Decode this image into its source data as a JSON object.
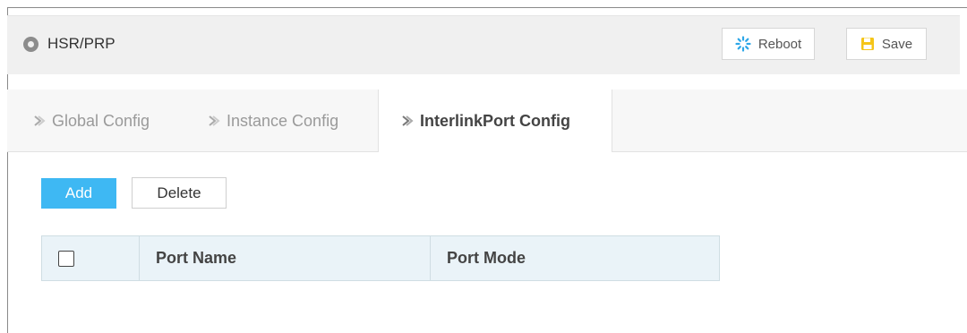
{
  "header": {
    "title": "HSR/PRP",
    "location_icon": "location-pin-icon",
    "reboot_label": "Reboot",
    "reboot_icon": "spinner-icon",
    "save_label": "Save",
    "save_icon": "floppy-disk-icon"
  },
  "tabs": [
    {
      "label": "Global Config",
      "icon": "chevron-right-icon",
      "active": false
    },
    {
      "label": "Instance Config",
      "icon": "chevron-right-icon",
      "active": false
    },
    {
      "label": "InterlinkPort Config",
      "icon": "chevron-right-icon",
      "active": true
    }
  ],
  "toolbar": {
    "add_label": "Add",
    "delete_label": "Delete"
  },
  "table": {
    "columns": [
      "",
      "Port Name",
      "Port Mode"
    ],
    "rows": []
  },
  "colors": {
    "accent": "#3eb8f3",
    "reboot_icon": "#2ea7e8",
    "save_icon": "#f5c518"
  }
}
